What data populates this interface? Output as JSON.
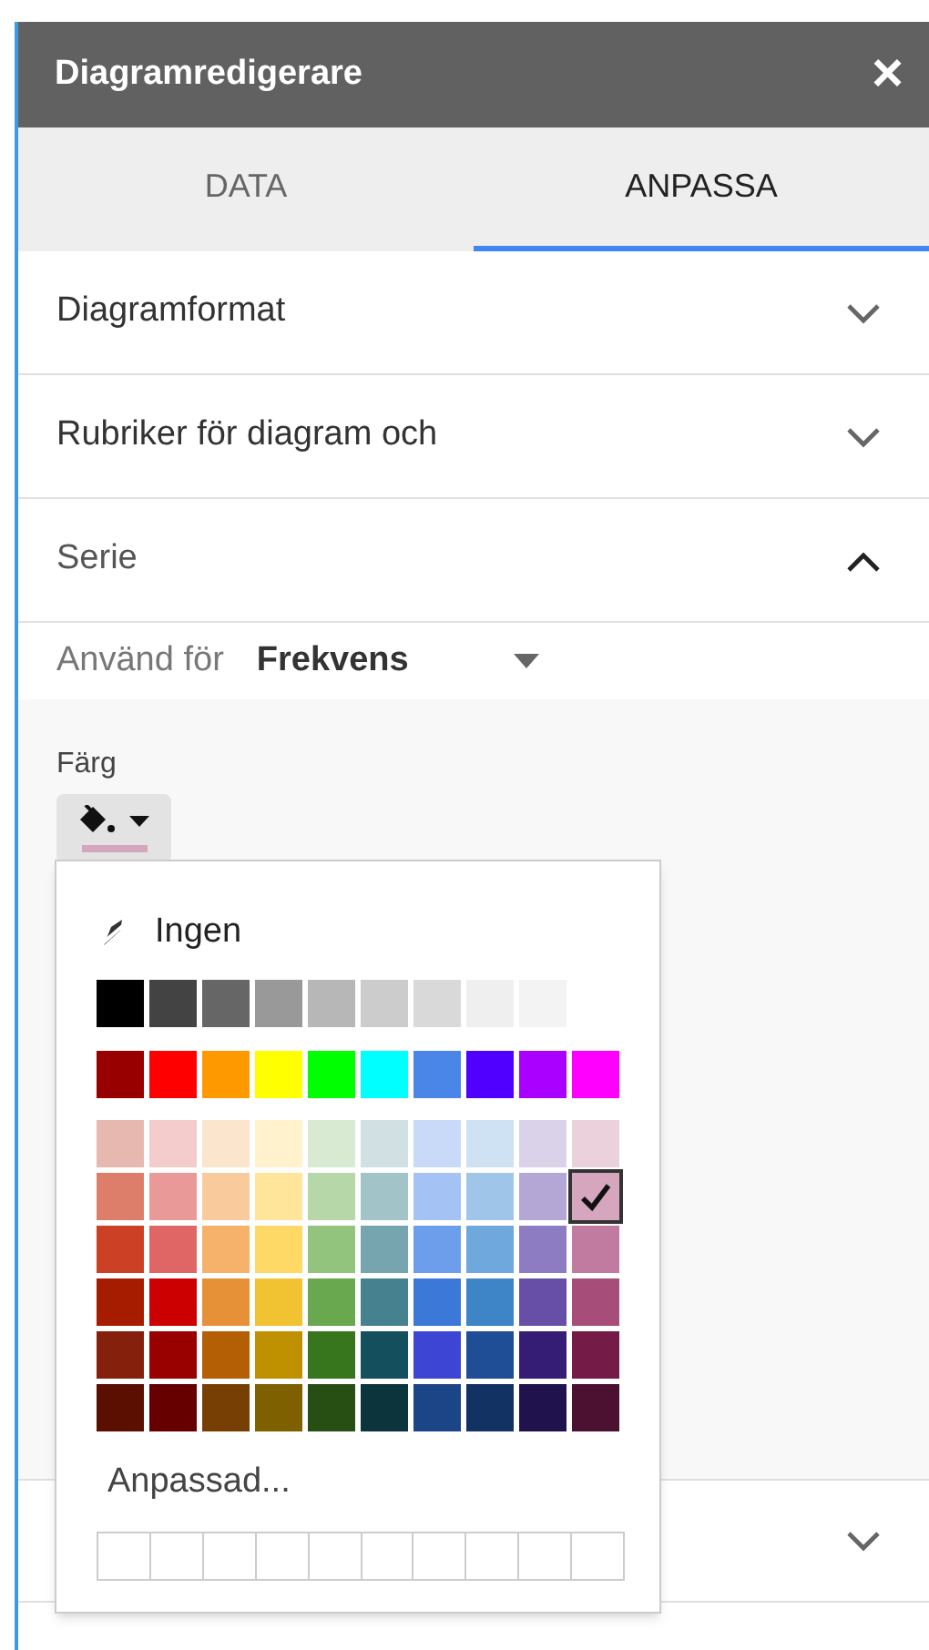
{
  "window": {
    "title": "Diagramredigerare",
    "close": "×"
  },
  "tabs": [
    {
      "label": "DATA",
      "selected": false
    },
    {
      "label": "ANPASSA",
      "selected": true
    }
  ],
  "sections": [
    {
      "title": "Diagramformat",
      "expanded": false
    },
    {
      "title": "Rubriker för diagram och",
      "expanded": false
    },
    {
      "title": "Serie",
      "expanded": true
    }
  ],
  "series": {
    "apply_label": "Använd för",
    "apply_value": "Frekvens",
    "color_label": "Färg"
  },
  "color_menu": {
    "none_label": "Ingen",
    "custom_label": "Anpassad...",
    "swatch_rows": [
      [
        {
          "color": "#000000",
          "selected": false
        },
        {
          "color": "#434343",
          "selected": false
        },
        {
          "color": "#666666",
          "selected": false
        },
        {
          "color": "#999999",
          "selected": false
        },
        {
          "color": "#b7b7b7",
          "selected": false
        },
        {
          "color": "#cccccc",
          "selected": false
        },
        {
          "color": "#d9d9d9",
          "selected": false
        },
        {
          "color": "#efefef",
          "selected": false
        },
        {
          "color": "#f3f3f3",
          "selected": false
        }
      ],
      [
        {
          "color": "#980000",
          "selected": false
        },
        {
          "color": "#ff0000",
          "selected": false
        },
        {
          "color": "#ff9900",
          "selected": false
        },
        {
          "color": "#ffff00",
          "selected": false
        },
        {
          "color": "#00ff00",
          "selected": false
        },
        {
          "color": "#00ffff",
          "selected": false
        },
        {
          "color": "#4a86e8",
          "selected": false
        },
        {
          "color": "#5000ff",
          "selected": false
        },
        {
          "color": "#aa00ff",
          "selected": false
        },
        {
          "color": "#ff00ff",
          "selected": false
        }
      ],
      [
        {
          "color": "#e6b8af",
          "selected": false
        },
        {
          "color": "#f4cccc",
          "selected": false
        },
        {
          "color": "#fce5cd",
          "selected": false
        },
        {
          "color": "#fff2cc",
          "selected": false
        },
        {
          "color": "#d9ead3",
          "selected": false
        },
        {
          "color": "#d0e0e3",
          "selected": false
        },
        {
          "color": "#c9daf8",
          "selected": false
        },
        {
          "color": "#cfe2f3",
          "selected": false
        },
        {
          "color": "#d9d2e9",
          "selected": false
        },
        {
          "color": "#ead1dc",
          "selected": false
        }
      ],
      [
        {
          "color": "#dd7e6b",
          "selected": false
        },
        {
          "color": "#ea9999",
          "selected": false
        },
        {
          "color": "#f9cb9c",
          "selected": false
        },
        {
          "color": "#ffe599",
          "selected": false
        },
        {
          "color": "#b6d7a8",
          "selected": false
        },
        {
          "color": "#a2c4c9",
          "selected": false
        },
        {
          "color": "#a4c2f4",
          "selected": false
        },
        {
          "color": "#9fc5e8",
          "selected": false
        },
        {
          "color": "#b4a7d6",
          "selected": false
        },
        {
          "color": "#d5a6bd",
          "selected": true
        }
      ],
      [
        {
          "color": "#cc4125",
          "selected": false
        },
        {
          "color": "#e06666",
          "selected": false
        },
        {
          "color": "#f6b26b",
          "selected": false
        },
        {
          "color": "#ffd966",
          "selected": false
        },
        {
          "color": "#93c47d",
          "selected": false
        },
        {
          "color": "#76a5af",
          "selected": false
        },
        {
          "color": "#6d9eeb",
          "selected": false
        },
        {
          "color": "#6fa8dc",
          "selected": false
        },
        {
          "color": "#8e7cc3",
          "selected": false
        },
        {
          "color": "#c27ba0",
          "selected": false
        }
      ],
      [
        {
          "color": "#a61c00",
          "selected": false
        },
        {
          "color": "#cc0000",
          "selected": false
        },
        {
          "color": "#e69138",
          "selected": false
        },
        {
          "color": "#f1c232",
          "selected": false
        },
        {
          "color": "#6aa84f",
          "selected": false
        },
        {
          "color": "#45818e",
          "selected": false
        },
        {
          "color": "#3c78d8",
          "selected": false
        },
        {
          "color": "#3d85c6",
          "selected": false
        },
        {
          "color": "#674ea7",
          "selected": false
        },
        {
          "color": "#a64d79",
          "selected": false
        }
      ],
      [
        {
          "color": "#85200c",
          "selected": false
        },
        {
          "color": "#990000",
          "selected": false
        },
        {
          "color": "#b45f06",
          "selected": false
        },
        {
          "color": "#bf9000",
          "selected": false
        },
        {
          "color": "#38761d",
          "selected": false
        },
        {
          "color": "#134f5c",
          "selected": false
        },
        {
          "color": "#3c45d4",
          "selected": false
        },
        {
          "color": "#1f4e96",
          "selected": false
        },
        {
          "color": "#351c75",
          "selected": false
        },
        {
          "color": "#741b47",
          "selected": false
        }
      ],
      [
        {
          "color": "#5b0f00",
          "selected": false
        },
        {
          "color": "#660000",
          "selected": false
        },
        {
          "color": "#783f04",
          "selected": false
        },
        {
          "color": "#7f6000",
          "selected": false
        },
        {
          "color": "#274e13",
          "selected": false
        },
        {
          "color": "#0c343d",
          "selected": false
        },
        {
          "color": "#1c4587",
          "selected": false
        },
        {
          "color": "#123263",
          "selected": false
        },
        {
          "color": "#20124d",
          "selected": false
        },
        {
          "color": "#4c1130",
          "selected": false
        }
      ]
    ]
  },
  "lower_sections": [
    {
      "expanded": false
    }
  ]
}
